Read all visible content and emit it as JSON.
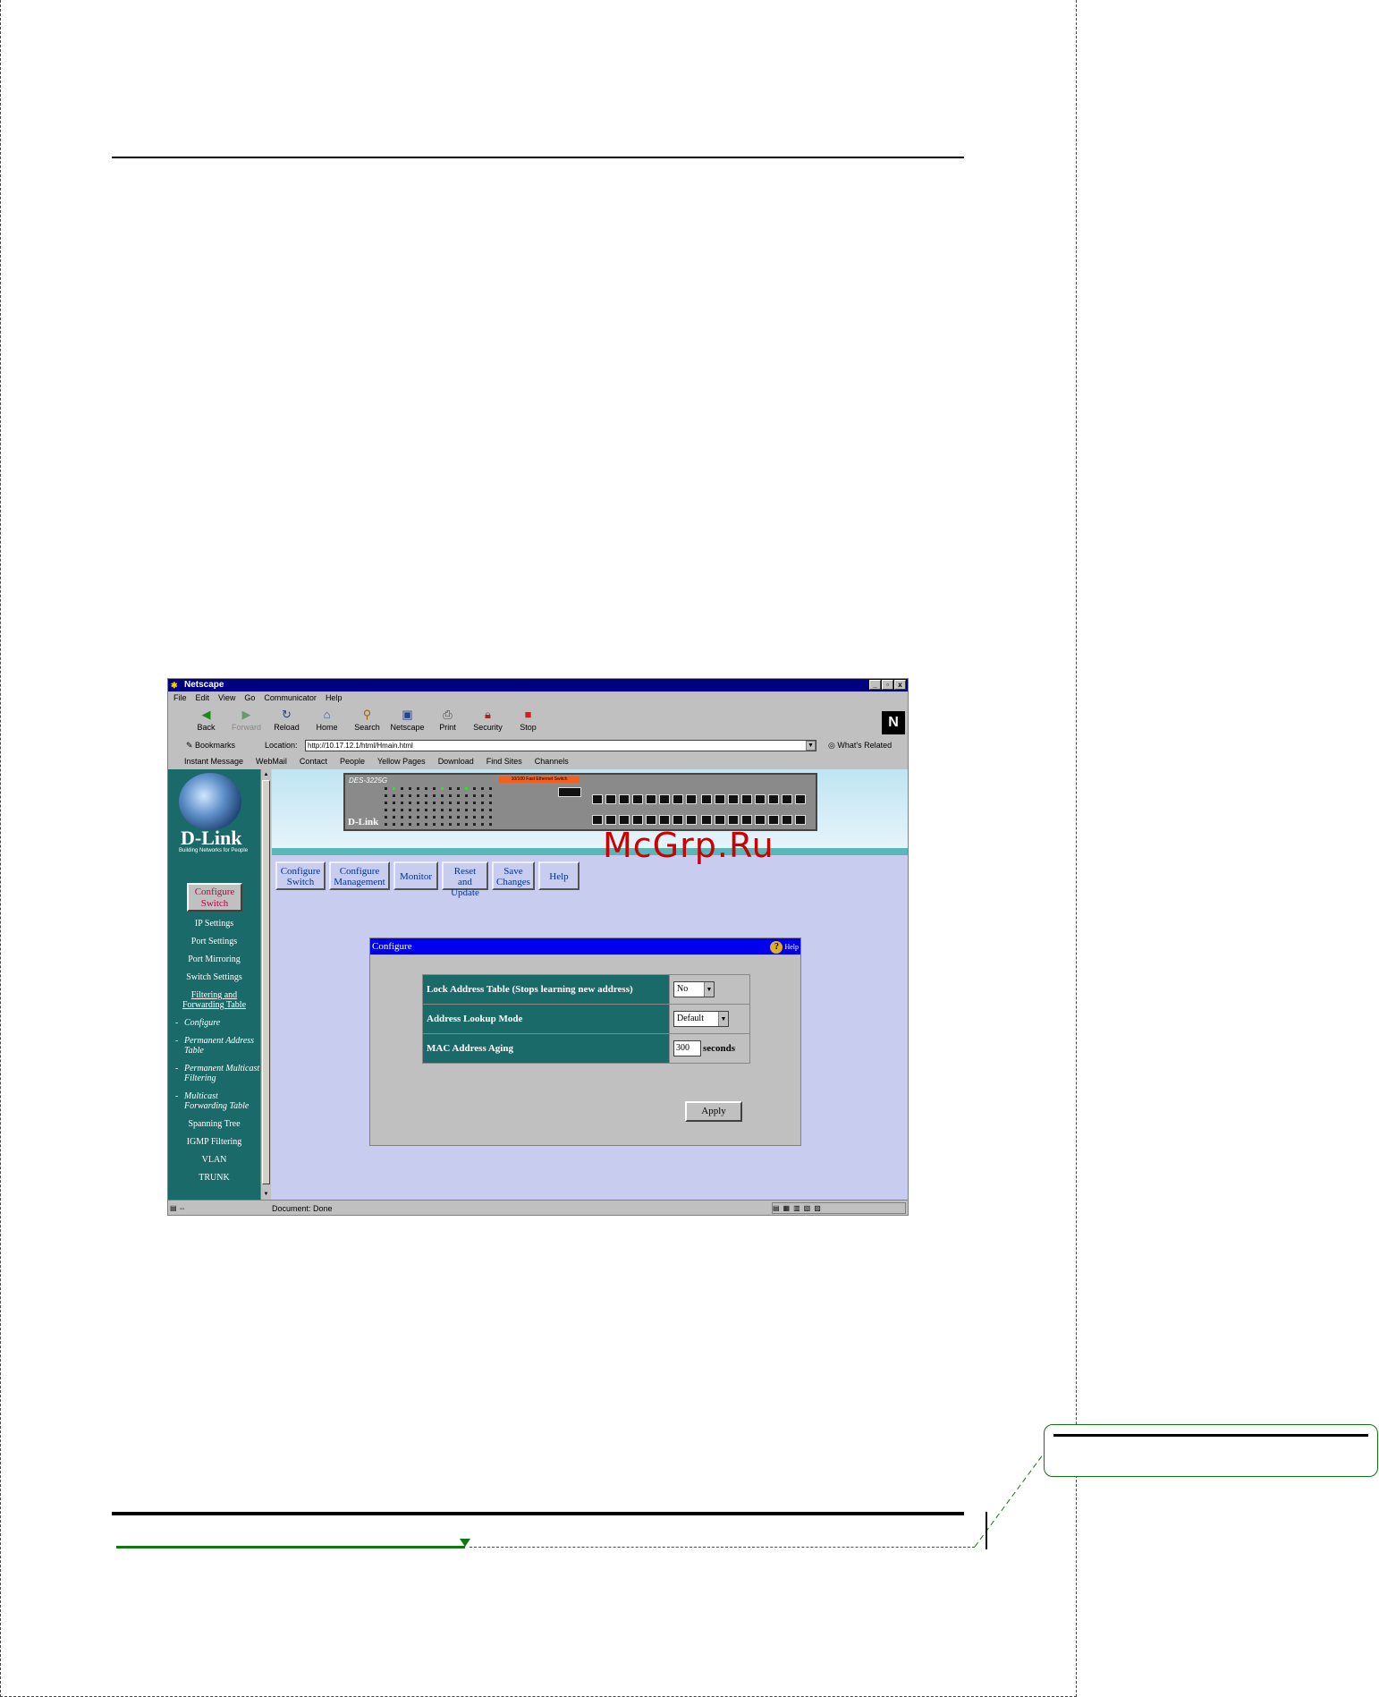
{
  "window": {
    "title": "Netscape",
    "controls": [
      "_",
      "▫",
      "x"
    ]
  },
  "menubar": [
    "File",
    "Edit",
    "View",
    "Go",
    "Communicator",
    "Help"
  ],
  "toolbar": [
    {
      "label": "Back",
      "icon": "back-arrow-icon"
    },
    {
      "label": "Forward",
      "icon": "forward-arrow-icon"
    },
    {
      "label": "Reload",
      "icon": "reload-icon"
    },
    {
      "label": "Home",
      "icon": "home-icon"
    },
    {
      "label": "Search",
      "icon": "search-icon"
    },
    {
      "label": "Netscape",
      "icon": "netscape-icon"
    },
    {
      "label": "Print",
      "icon": "print-icon"
    },
    {
      "label": "Security",
      "icon": "lock-icon"
    },
    {
      "label": "Stop",
      "icon": "stop-icon"
    }
  ],
  "nlogo": "N",
  "location": {
    "bookmarks": "Bookmarks",
    "label": "Location:",
    "url": "http://10.17.12.1/html/Hmain.html",
    "related": "What's Related"
  },
  "personal": [
    "Instant Message",
    "WebMail",
    "Contact",
    "People",
    "Yellow Pages",
    "Download",
    "Find Sites",
    "Channels"
  ],
  "leftframe": {
    "brand": "D-Link",
    "tagline": "Building Networks for People",
    "configure_button": "Configure Switch",
    "nav": [
      {
        "label": "IP Settings",
        "sub": false
      },
      {
        "label": "Port Settings",
        "sub": false
      },
      {
        "label": "Port Mirroring",
        "sub": false
      },
      {
        "label": "Switch Settings",
        "sub": false
      },
      {
        "label": "Filtering and Forwarding Table",
        "sub": false
      },
      {
        "label": "Configure",
        "sub": true
      },
      {
        "label": "Permanent Address Table",
        "sub": true
      },
      {
        "label": "Permanent Multicast Filtering",
        "sub": true
      },
      {
        "label": "Multicast Forwarding Table",
        "sub": true
      },
      {
        "label": "Spanning Tree",
        "sub": false
      },
      {
        "label": "IGMP Filtering",
        "sub": false
      },
      {
        "label": "VLAN",
        "sub": false
      },
      {
        "label": "TRUNK",
        "sub": false
      }
    ]
  },
  "banner": {
    "model": "DES-3225G",
    "brand": "D-Link",
    "tag": "10/100 Fast Ethernet Switch"
  },
  "topnav": [
    "Configure Switch",
    "Configure Management",
    "Monitor",
    "Reset and Update",
    "Save Changes",
    "Help"
  ],
  "panel": {
    "title": "Configure",
    "help": "Help",
    "rows": [
      {
        "label": "Lock Address Table (Stops learning new address)",
        "value": "No"
      },
      {
        "label": "Address Lookup Mode",
        "value": "Default"
      },
      {
        "label": "MAC Address Aging",
        "value": "300",
        "unit": "seconds"
      }
    ],
    "apply": "Apply"
  },
  "status": {
    "text": "Document: Done"
  },
  "watermark": "McGrp.Ru"
}
